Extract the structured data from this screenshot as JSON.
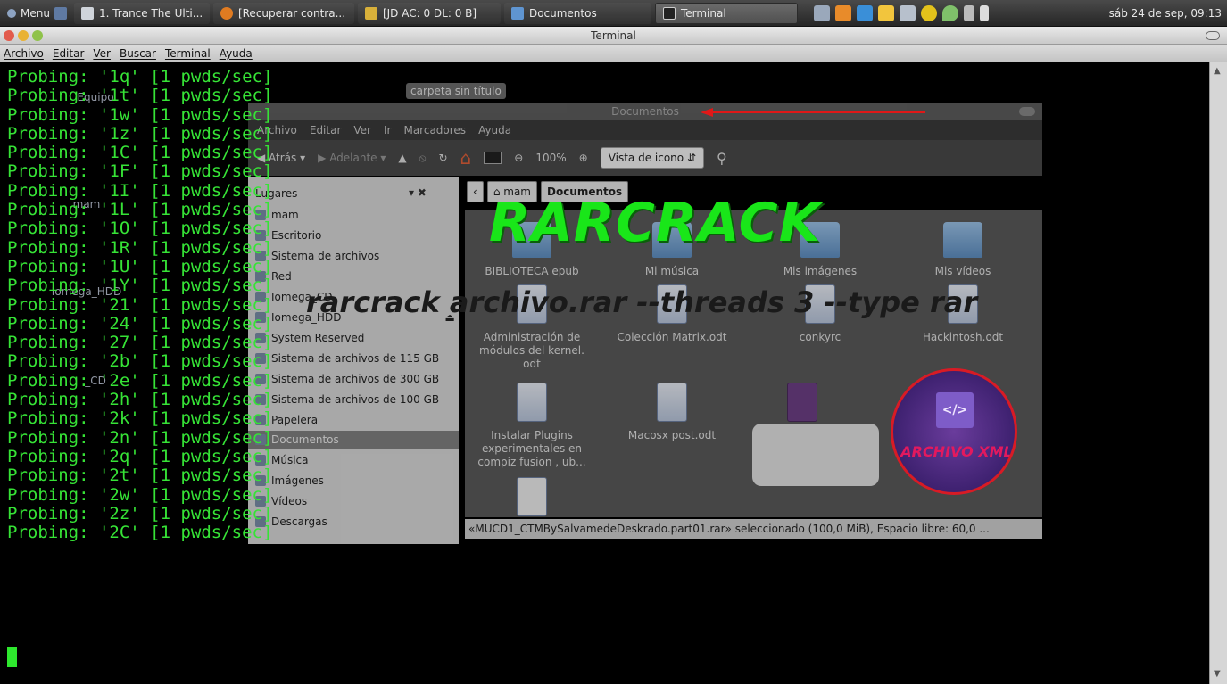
{
  "panel": {
    "menu_label": "Menu",
    "tasks": [
      {
        "label": "1. Trance The Ulti...",
        "icon": "media-player-icon"
      },
      {
        "label": "[Recuperar contra...",
        "icon": "firefox-icon"
      },
      {
        "label": "[JD AC: 0 DL: 0 B]",
        "icon": "jdownloader-icon"
      },
      {
        "label": "Documentos",
        "icon": "folder-icon"
      },
      {
        "label": "Terminal",
        "icon": "terminal-icon",
        "active": true
      }
    ],
    "clock": "sáb 24 de sep, 09:13"
  },
  "terminal": {
    "window_title": "Terminal",
    "menu": [
      "Archivo",
      "Editar",
      "Ver",
      "Buscar",
      "Terminal",
      "Ayuda"
    ],
    "output_lines": [
      "Probing: '1q' [1 pwds/sec]",
      "Probing: '1t' [1 pwds/sec]",
      "Probing: '1w' [1 pwds/sec]",
      "Probing: '1z' [1 pwds/sec]",
      "Probing: '1C' [1 pwds/sec]",
      "Probing: '1F' [1 pwds/sec]",
      "Probing: '1I' [1 pwds/sec]",
      "Probing: '1L' [1 pwds/sec]",
      "Probing: '1O' [1 pwds/sec]",
      "Probing: '1R' [1 pwds/sec]",
      "Probing: '1U' [1 pwds/sec]",
      "Probing: '1Y' [1 pwds/sec]",
      "Probing: '21' [1 pwds/sec]",
      "Probing: '24' [1 pwds/sec]",
      "Probing: '27' [1 pwds/sec]",
      "Probing: '2b' [1 pwds/sec]",
      "Probing: '2e' [1 pwds/sec]",
      "Probing: '2h' [1 pwds/sec]",
      "Probing: '2k' [1 pwds/sec]",
      "Probing: '2n' [1 pwds/sec]",
      "Probing: '2q' [1 pwds/sec]",
      "Probing: '2t' [1 pwds/sec]",
      "Probing: '2w' [1 pwds/sec]",
      "Probing: '2z' [1 pwds/sec]",
      "Probing: '2C' [1 pwds/sec]"
    ]
  },
  "desktop": {
    "chip": "carpeta sin título",
    "icons": [
      "Equipo",
      "mam",
      "Iomega_HDD",
      "_CD"
    ]
  },
  "file_manager": {
    "title": "Documentos",
    "menu": [
      "Archivo",
      "Editar",
      "Ver",
      "Ir",
      "Marcadores",
      "Ayuda"
    ],
    "toolbar": {
      "back": "Atrás",
      "forward": "Adelante",
      "zoom": "100%",
      "view_mode": "Vista de icono"
    },
    "path": [
      "mam",
      "Documentos"
    ],
    "sidebar_header": "Lugares",
    "sidebar": [
      "mam",
      "Escritorio",
      "Sistema de archivos",
      "Red",
      "Iomega_CD",
      "Iomega_HDD",
      "System Reserved",
      "Sistema de archivos de 115 GB",
      "Sistema de archivos de 300 GB",
      "Sistema de archivos de 100 GB",
      "Papelera",
      "Documentos",
      "Música",
      "Imágenes",
      "Vídeos",
      "Descargas"
    ],
    "files": [
      {
        "name": "BIBLIOTECA epub",
        "kind": "folder"
      },
      {
        "name": "Mi música",
        "kind": "folder"
      },
      {
        "name": "Mis imágenes",
        "kind": "folder"
      },
      {
        "name": "Mis vídeos",
        "kind": "folder"
      },
      {
        "name": "Administración de módulos del kernel. odt",
        "kind": "doc"
      },
      {
        "name": "Colección Matrix.odt",
        "kind": "doc"
      },
      {
        "name": "conkyrc",
        "kind": "doc"
      },
      {
        "name": "Hackintosh.odt",
        "kind": "doc"
      },
      {
        "name": "Instalar Plugins experimentales en compiz fusion , ub...",
        "kind": "doc"
      },
      {
        "name": "Macosx post.odt",
        "kind": "doc"
      }
    ],
    "status": "«MUCD1_CTMBySalvamedeDeskrado.part01.rar» seleccionado (100,0 MiB), Espacio libre: 60,0 ..."
  },
  "overlay": {
    "title": "RARCRACK",
    "command": "rarcrack archivo.rar --threads 3 --type rar",
    "badge_label": "ARCHIVO XML",
    "badge_code": "</>",
    "arrow_color": "#e01818",
    "title_color": "#19e619"
  }
}
